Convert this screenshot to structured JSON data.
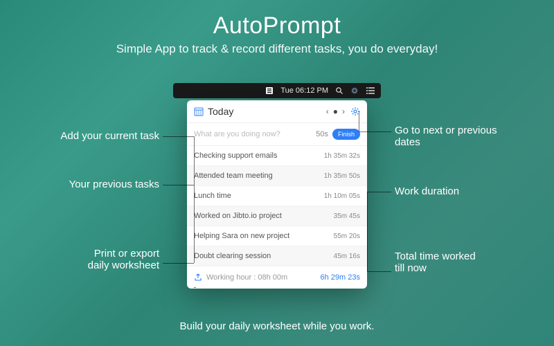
{
  "hero": {
    "title": "AutoPrompt",
    "subtitle": "Simple App to track & record different tasks, you do everyday!"
  },
  "menubar": {
    "time": "Tue 06:12 PM"
  },
  "panel": {
    "title": "Today",
    "input_placeholder": "What are you doing now?",
    "input_elapsed": "50s",
    "finish_label": "Finish",
    "tasks": [
      {
        "name": "Checking support emails",
        "duration": "1h 35m 32s"
      },
      {
        "name": "Attended team meeting",
        "duration": "1h 35m 50s"
      },
      {
        "name": "Lunch time",
        "duration": "1h 10m 05s"
      },
      {
        "name": "Worked on Jibto.io project",
        "duration": "35m 45s"
      },
      {
        "name": "Helping Sara on new project",
        "duration": "55m 20s"
      },
      {
        "name": "Doubt clearing session",
        "duration": "45m 16s"
      }
    ],
    "working_hour_label": "Working hour : 08h 00m",
    "total_time": "6h 29m 23s"
  },
  "callouts": {
    "add_task": "Add your current task",
    "prev_tasks": "Your previous tasks",
    "print_export": "Print or export\ndaily worksheet",
    "nav_dates": "Go to next or previous\ndates",
    "work_duration": "Work duration",
    "total_time": "Total time worked\ntill now"
  },
  "footer": "Build your daily worksheet while you work."
}
